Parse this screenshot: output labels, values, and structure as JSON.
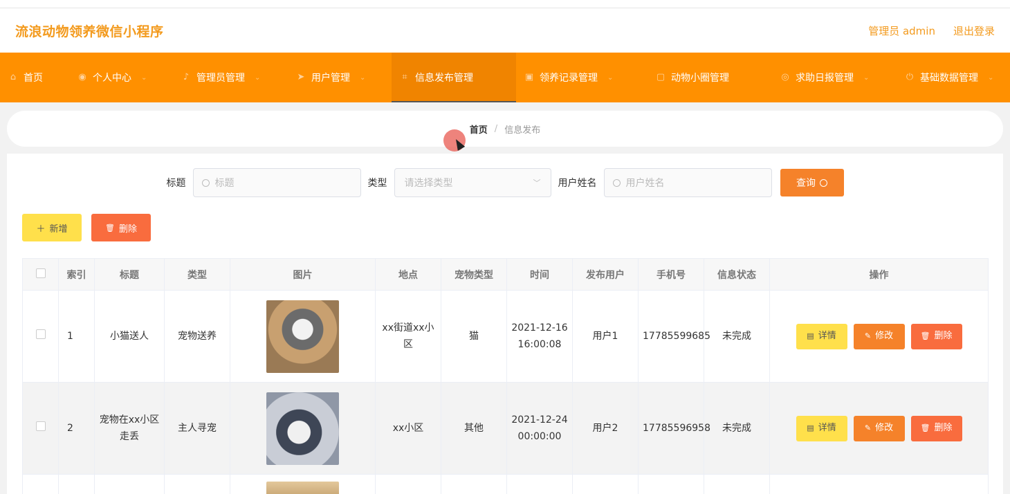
{
  "app": {
    "title": "流浪动物领养微信小程序"
  },
  "header": {
    "user": "管理员 admin",
    "logout": "退出登录"
  },
  "nav": [
    {
      "label": "首页",
      "icon": "home-icon",
      "glyph": "⌂",
      "has_menu": false
    },
    {
      "label": "个人中心",
      "icon": "user-icon",
      "glyph": "◉",
      "has_menu": true
    },
    {
      "label": "管理员管理",
      "icon": "mic-icon",
      "glyph": "♪",
      "has_menu": true
    },
    {
      "label": "用户管理",
      "icon": "send-icon",
      "glyph": "➤",
      "has_menu": true
    },
    {
      "label": "信息发布管理",
      "icon": "crop-icon",
      "glyph": "⌗",
      "has_menu": false,
      "active": true
    },
    {
      "label": "领养记录管理",
      "icon": "chat-icon",
      "glyph": "▣",
      "has_menu": true
    },
    {
      "label": "动物小圈管理",
      "icon": "comment-icon",
      "glyph": "▢",
      "has_menu": false
    },
    {
      "label": "求助日报管理",
      "icon": "globe-icon",
      "glyph": "◎",
      "has_menu": true
    },
    {
      "label": "基础数据管理",
      "icon": "power-icon",
      "glyph": "⏻",
      "has_menu": true
    }
  ],
  "breadcrumb": {
    "home": "首页",
    "separator": "/",
    "current": "信息发布"
  },
  "search": {
    "title_label": "标题",
    "title_placeholder": "标题",
    "type_label": "类型",
    "type_placeholder": "请选择类型",
    "user_label": "用户姓名",
    "user_placeholder": "用户姓名",
    "query_button": "查询"
  },
  "actions": {
    "add": "新增",
    "delete": "删除"
  },
  "table": {
    "headers": [
      "索引",
      "标题",
      "类型",
      "图片",
      "地点",
      "宠物类型",
      "时间",
      "发布用户",
      "手机号",
      "信息状态",
      "操作"
    ],
    "rows": [
      {
        "index": "1",
        "title": "小猫送人",
        "type": "宠物送养",
        "image": "cat",
        "place": "xx街道xx小区",
        "pet": "猫",
        "time": "2021-12-16 16:00:08",
        "user": "用户1",
        "phone": "17785599685",
        "status": "未完成"
      },
      {
        "index": "2",
        "title": "宠物在xx小区走丢",
        "type": "主人寻宠",
        "image": "dog",
        "place": "xx小区",
        "pet": "其他",
        "time": "2021-12-24 00:00:00",
        "user": "用户2",
        "phone": "17785596958",
        "status": "未完成"
      }
    ],
    "ops": {
      "detail": "详情",
      "edit": "修改",
      "remove": "删除"
    }
  }
}
